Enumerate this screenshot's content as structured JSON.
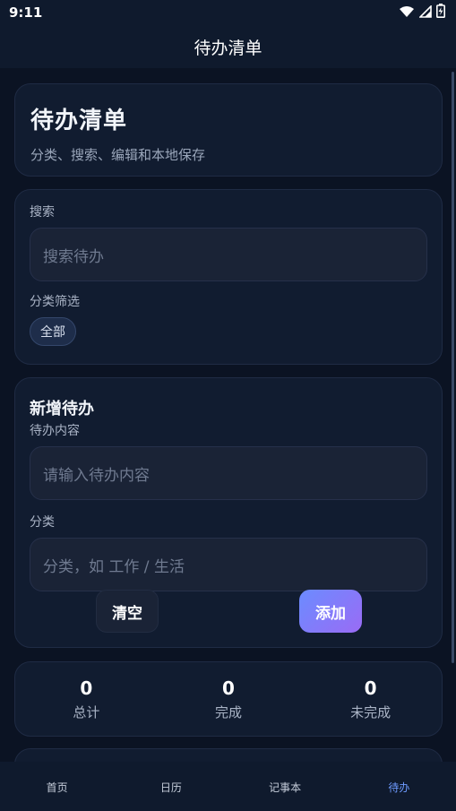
{
  "status_bar": {
    "time": "9:11",
    "icons": [
      "wifi-icon",
      "signal-icon",
      "battery-icon"
    ]
  },
  "app_bar": {
    "title": "待办清单"
  },
  "header": {
    "title": "待办清单",
    "subtitle": "分类、搜索、编辑和本地保存"
  },
  "filter": {
    "search_label": "搜索",
    "search_placeholder": "搜索待办",
    "category_filter_label": "分类筛选",
    "chips": [
      "全部"
    ]
  },
  "add_todo": {
    "title": "新增待办",
    "content_label": "待办内容",
    "content_placeholder": "请输入待办内容",
    "category_label": "分类",
    "category_placeholder": "分类，如 工作 / 生活",
    "clear_label": "清空",
    "add_label": "添加"
  },
  "stats": [
    {
      "value": "0",
      "label": "总计"
    },
    {
      "value": "0",
      "label": "完成"
    },
    {
      "value": "0",
      "label": "未完成"
    }
  ],
  "bottom_nav": [
    {
      "label": "首页",
      "active": false
    },
    {
      "label": "日历",
      "active": false
    },
    {
      "label": "记事本",
      "active": false
    },
    {
      "label": "待办",
      "active": true
    }
  ],
  "colors": {
    "background": "#0b1323",
    "card": "#111c30",
    "accent": "#6e9bff",
    "add_gradient_start": "#6b8cff",
    "add_gradient_end": "#9a6bf5"
  }
}
